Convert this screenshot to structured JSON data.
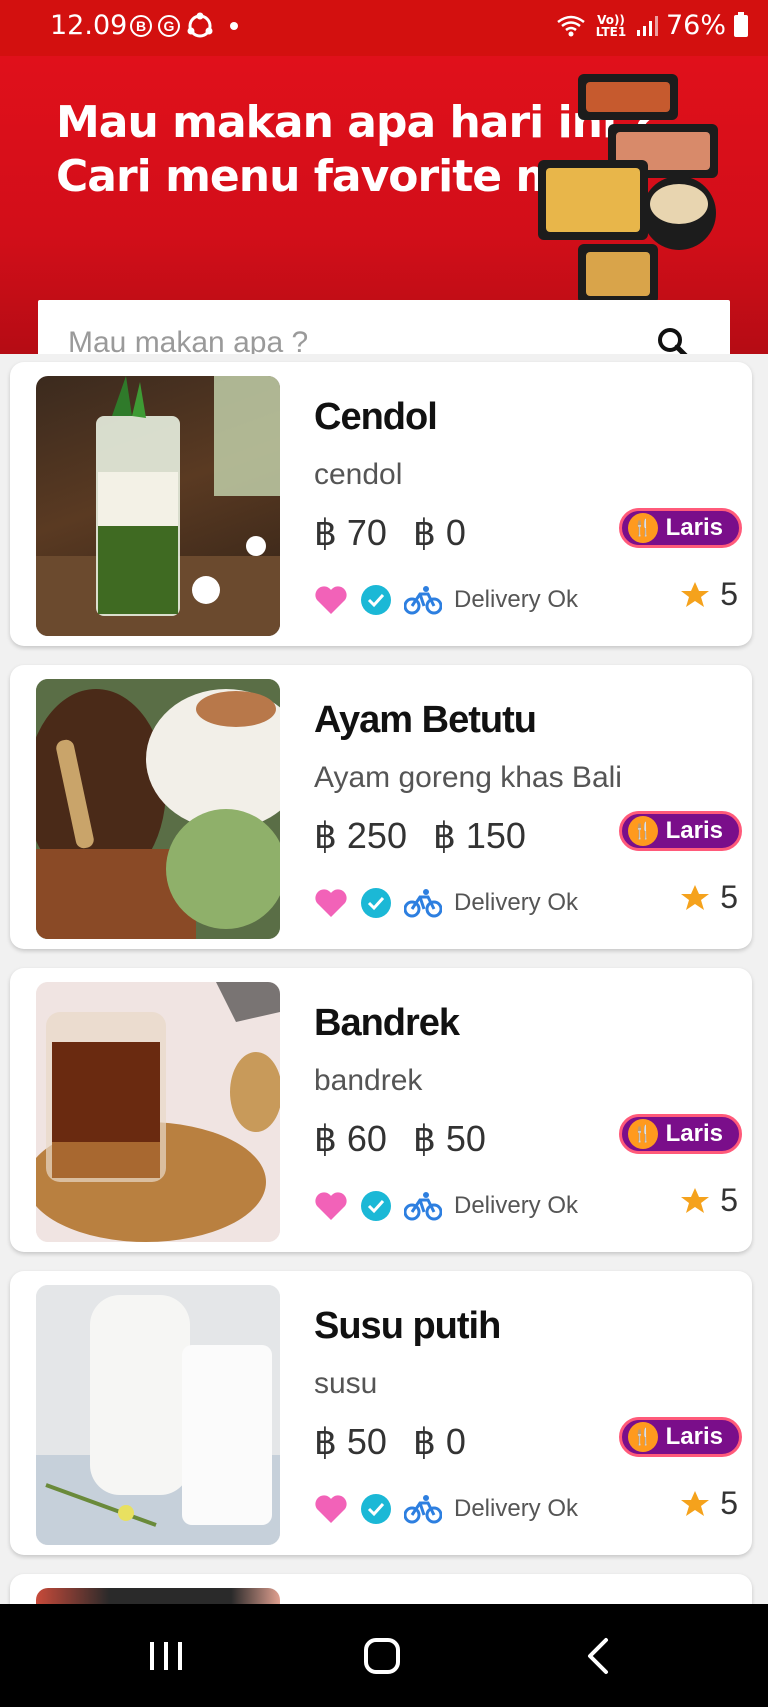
{
  "status": {
    "time": "12.09",
    "left_badges": [
      "B",
      "G"
    ],
    "network": "Vo)) LTE1",
    "battery": "76%"
  },
  "banner": {
    "line1": "Mau makan apa hari ini ?",
    "line2": "Cari menu favorite mu"
  },
  "search": {
    "placeholder": "Mau makan apa ?"
  },
  "items": [
    {
      "name": "Cendol",
      "desc": "cendol",
      "price1": "฿ 70",
      "price2": "฿ 0",
      "badge": "Laris",
      "delivery": "Delivery Ok",
      "rating": "5"
    },
    {
      "name": "Ayam Betutu",
      "desc": "Ayam goreng khas Bali",
      "price1": "฿ 250",
      "price2": "฿ 150",
      "badge": "Laris",
      "delivery": "Delivery Ok",
      "rating": "5"
    },
    {
      "name": "Bandrek",
      "desc": "bandrek",
      "price1": "฿ 60",
      "price2": "฿ 50",
      "badge": "Laris",
      "delivery": "Delivery Ok",
      "rating": "5"
    },
    {
      "name": "Susu putih",
      "desc": "susu",
      "price1": "฿ 50",
      "price2": "฿ 0",
      "badge": "Laris",
      "delivery": "Delivery Ok",
      "rating": "5"
    }
  ],
  "colors": {
    "brand_red": "#d3100f",
    "badge_purple": "#7a0e8a",
    "heart_pink": "#f262b8",
    "check_teal": "#1bb8d6",
    "bike_blue": "#2d7fe0",
    "star_orange": "#f5a21c"
  },
  "icons": [
    "search-icon",
    "heart-icon",
    "check-icon",
    "bicycle-icon",
    "star-icon",
    "restaurant-icon",
    "recents-icon",
    "home-icon",
    "back-icon"
  ]
}
